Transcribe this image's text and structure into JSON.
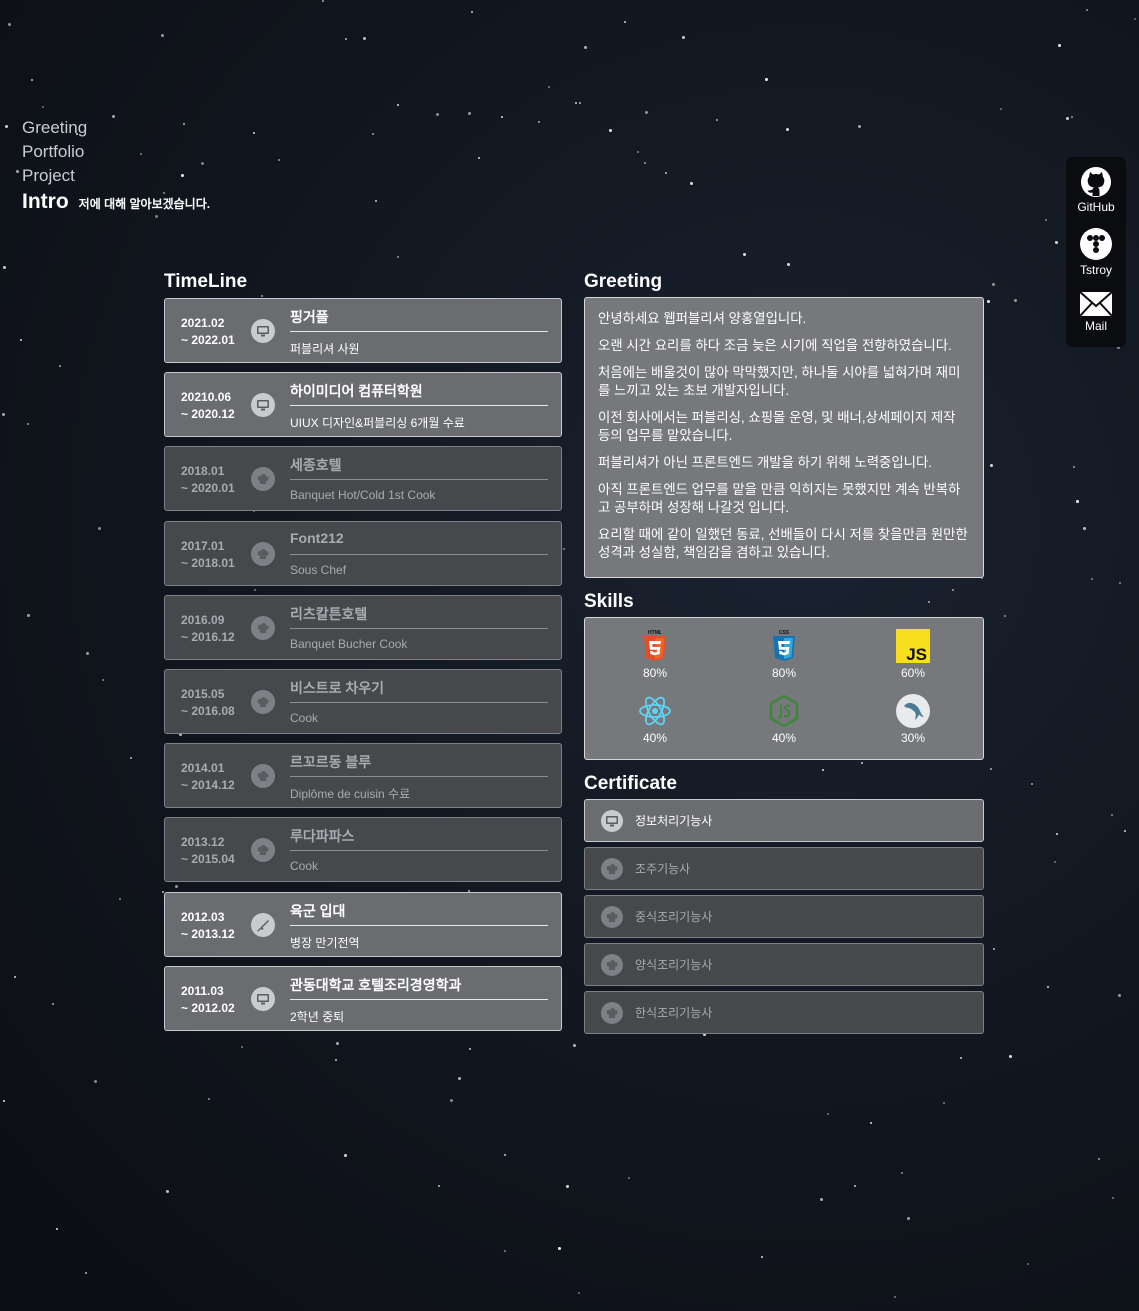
{
  "nav": {
    "items": [
      "Greeting",
      "Portfolio",
      "Project"
    ],
    "active": "Intro",
    "active_desc": "저에 대해 알아보겠습니다."
  },
  "social": [
    {
      "label": "GitHub",
      "icon": "github-icon"
    },
    {
      "label": "Tstroy",
      "icon": "tistory-icon"
    },
    {
      "label": "Mail",
      "icon": "mail-icon"
    }
  ],
  "timeline": {
    "title": "TimeLine",
    "items": [
      {
        "date1": "2021.02",
        "date2": "~ 2022.01",
        "title": "핑거플",
        "sub": "퍼블리셔 사원",
        "icon": "computer-icon",
        "active": true
      },
      {
        "date1": "20210.06",
        "date2": "~ 2020.12",
        "title": "하이미디어 컴퓨터학원",
        "sub": "UIUX 디자인&퍼블리싱 6개월 수료",
        "icon": "computer-icon",
        "active": true
      },
      {
        "date1": "2018.01",
        "date2": "~ 2020.01",
        "title": "세종호텔",
        "sub": "Banquet Hot/Cold 1st Cook",
        "icon": "chef-hat-icon",
        "active": false
      },
      {
        "date1": "2017.01",
        "date2": "~ 2018.01",
        "title": "Font212",
        "sub": "Sous Chef",
        "icon": "chef-hat-icon",
        "active": false
      },
      {
        "date1": "2016.09",
        "date2": "~ 2016.12",
        "title": "리츠칼튼호텔",
        "sub": "Banquet Bucher Cook",
        "icon": "chef-hat-icon",
        "active": false
      },
      {
        "date1": "2015.05",
        "date2": "~ 2016.08",
        "title": "비스트로 차우기",
        "sub": "Cook",
        "icon": "chef-hat-icon",
        "active": false
      },
      {
        "date1": "2014.01",
        "date2": "~ 2014.12",
        "title": "르꼬르동 블루",
        "sub": "Diplôme de cuisin 수료",
        "icon": "chef-hat-icon",
        "active": false
      },
      {
        "date1": "2013.12",
        "date2": "~ 2015.04",
        "title": "루다파파스",
        "sub": "Cook",
        "icon": "chef-hat-icon",
        "active": false
      },
      {
        "date1": "2012.03",
        "date2": "~ 2013.12",
        "title": "육군 입대",
        "sub": "병장 만기전역",
        "icon": "rifle-icon",
        "active": true
      },
      {
        "date1": "2011.03",
        "date2": "~ 2012.02",
        "title": "관동대학교 호텔조리경영학과",
        "sub": "2학년 중퇴",
        "icon": "computer-icon",
        "active": true
      }
    ]
  },
  "greeting": {
    "title": "Greeting",
    "paragraphs": [
      "안녕하세요 웹퍼블리셔 양홍열입니다.",
      "오랜 시간 요리를 하다 조금 늦은 시기에 직업을 전향하였습니다.",
      "처음에는 배울것이 많아 막막했지만, 하나둘 시야를 넓혀가며 재미를 느끼고 있는 초보 개발자입니다.",
      "이전 회사에서는 퍼블리싱, 쇼핑몰 운영, 및 배너,상세페이지 제작 등의 업무를 맡았습니다.",
      "퍼블리셔가 아닌 프론트엔드 개발을 하기 위해 노력중입니다.",
      "아직 프론트엔드 업무를 맡을 만큼 익히지는 못했지만 계속 반복하고 공부하며 성장해 나갈것 입니다.",
      "요리할 때에 같이 일했던 동료, 선배들이 다시 저를 찾을만큼 원만한 성격과 성실함, 책임감을 겸하고 있습니다."
    ]
  },
  "skills": {
    "title": "Skills",
    "items": [
      {
        "name": "html5-logo",
        "percent": "80%",
        "value": 80
      },
      {
        "name": "css3-logo",
        "percent": "80%",
        "value": 80
      },
      {
        "name": "javascript-logo",
        "percent": "60%",
        "value": 60
      },
      {
        "name": "react-logo",
        "percent": "40%",
        "value": 40
      },
      {
        "name": "nodejs-logo",
        "percent": "40%",
        "value": 40
      },
      {
        "name": "mysql-logo",
        "percent": "30%",
        "value": 30
      }
    ],
    "logo_text": {
      "html": "HTML",
      "css": "CSS",
      "js": "JS"
    }
  },
  "certificate": {
    "title": "Certificate",
    "items": [
      {
        "label": "정보처리기능사",
        "icon": "computer-icon",
        "active": true
      },
      {
        "label": "조주기능사",
        "icon": "chef-hat-icon",
        "active": false
      },
      {
        "label": "중식조리기능사",
        "icon": "chef-hat-icon",
        "active": false
      },
      {
        "label": "양식조리기능사",
        "icon": "chef-hat-icon",
        "active": false
      },
      {
        "label": "한식조리기능사",
        "icon": "chef-hat-icon",
        "active": false
      }
    ]
  },
  "colors": {
    "background": "#11151d",
    "card_active": "#6a6c70",
    "card_dim": "#46484c",
    "box": "#76787c"
  }
}
